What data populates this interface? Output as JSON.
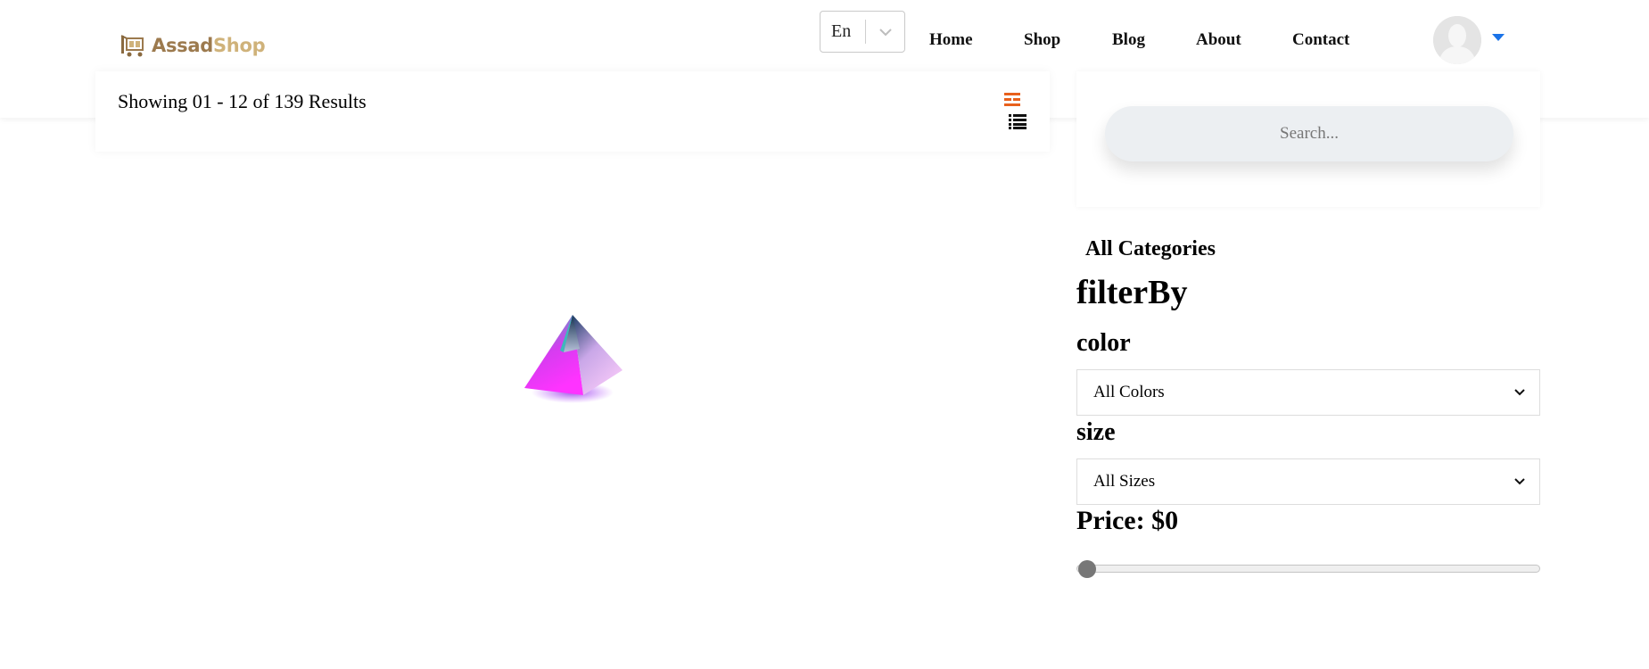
{
  "header": {
    "logo": {
      "part1": "Assad",
      "part2": "Shop"
    },
    "language": {
      "selected": "En"
    },
    "nav": [
      {
        "label": "Home"
      },
      {
        "label": "Shop"
      },
      {
        "label": "Blog"
      },
      {
        "label": "About"
      },
      {
        "label": "Contact"
      }
    ],
    "icons": {
      "avatar": "user-avatar",
      "caret": "caret-down-icon"
    }
  },
  "results": {
    "text": "Showing 01 - 12 of 139 Results",
    "views": [
      "grid-view-icon",
      "list-view-icon"
    ]
  },
  "search": {
    "placeholder": "Search..."
  },
  "filters": {
    "all_categories": "All Categories",
    "title": "filterBy",
    "color_label": "color",
    "color_selected": "All Colors",
    "size_label": "size",
    "size_selected": "All Sizes",
    "price_label": "Price: $0",
    "price_value_fraction": 0
  },
  "colors": {
    "accent": "#e8601c",
    "caret": "#1a73e8",
    "logo_dark": "#9c7a4e",
    "logo_light": "#cfb27a",
    "loader_pink": "#ff33ff",
    "loader_teal": "#2ec5b4"
  }
}
